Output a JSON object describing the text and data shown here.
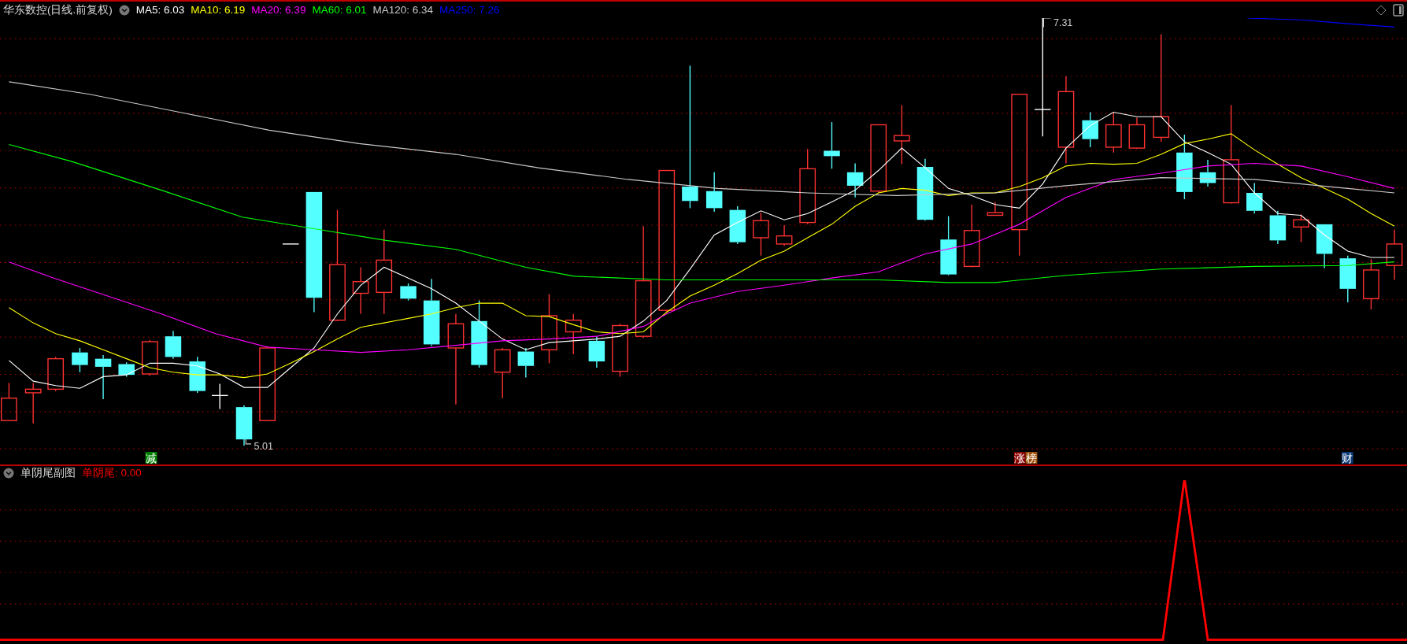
{
  "main_chart": {
    "title": "华东数控(日线.前复权)",
    "indicators": [
      {
        "label": "MA5: 6.03",
        "color": "#ffffff"
      },
      {
        "label": "MA10: 6.19",
        "color": "#ffff00"
      },
      {
        "label": "MA20: 6.39",
        "color": "#ff00ff"
      },
      {
        "label": "MA60: 6.01",
        "color": "#00ff00"
      },
      {
        "label": "MA120: 6.34",
        "color": "#c8c8c8"
      },
      {
        "label": "MA250: 7.26",
        "color": "#0000ff"
      }
    ],
    "high_label": "7.31",
    "low_label": "5.01",
    "markers": [
      {
        "text": "减",
        "color": "#008000"
      },
      {
        "text": "涨",
        "color": "#8b0000"
      },
      {
        "text": "榜",
        "color": "#a0520a"
      },
      {
        "text": "财",
        "color": "#0a3a78"
      }
    ]
  },
  "sub_chart": {
    "title": "单阴尾副图",
    "indicator": {
      "label": "单阴尾: 0.00",
      "color": "#ff0000"
    }
  }
}
